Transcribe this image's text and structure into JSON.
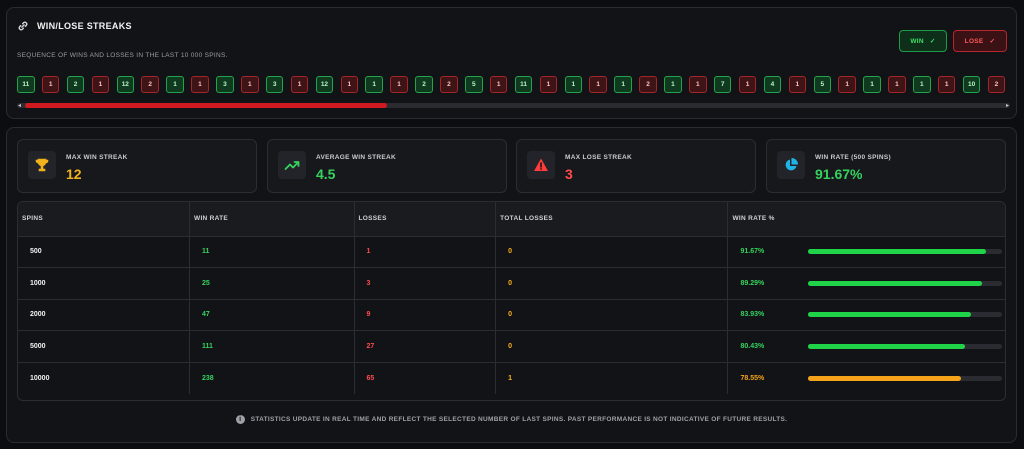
{
  "streaks": {
    "title": "WIN/LOSE STREAKS",
    "subtitle": "SEQUENCE OF WINS AND LOSSES IN THE LAST 10 000 SPINS.",
    "win_label": "WIN",
    "lose_label": "LOSE",
    "sequence": [
      {
        "t": "w",
        "v": "11"
      },
      {
        "t": "l",
        "v": "1"
      },
      {
        "t": "w",
        "v": "2"
      },
      {
        "t": "l",
        "v": "1"
      },
      {
        "t": "w",
        "v": "12"
      },
      {
        "t": "l",
        "v": "2"
      },
      {
        "t": "w",
        "v": "1"
      },
      {
        "t": "l",
        "v": "1"
      },
      {
        "t": "w",
        "v": "3"
      },
      {
        "t": "l",
        "v": "1"
      },
      {
        "t": "w",
        "v": "3"
      },
      {
        "t": "l",
        "v": "1"
      },
      {
        "t": "w",
        "v": "12"
      },
      {
        "t": "l",
        "v": "1"
      },
      {
        "t": "w",
        "v": "1"
      },
      {
        "t": "l",
        "v": "1"
      },
      {
        "t": "w",
        "v": "2"
      },
      {
        "t": "l",
        "v": "2"
      },
      {
        "t": "w",
        "v": "5"
      },
      {
        "t": "l",
        "v": "1"
      },
      {
        "t": "w",
        "v": "11"
      },
      {
        "t": "l",
        "v": "1"
      },
      {
        "t": "w",
        "v": "1"
      },
      {
        "t": "l",
        "v": "1"
      },
      {
        "t": "w",
        "v": "1"
      },
      {
        "t": "l",
        "v": "2"
      },
      {
        "t": "w",
        "v": "1"
      },
      {
        "t": "l",
        "v": "1"
      },
      {
        "t": "w",
        "v": "7"
      },
      {
        "t": "l",
        "v": "1"
      },
      {
        "t": "w",
        "v": "4"
      },
      {
        "t": "l",
        "v": "1"
      },
      {
        "t": "w",
        "v": "5"
      },
      {
        "t": "l",
        "v": "1"
      },
      {
        "t": "w",
        "v": "1"
      },
      {
        "t": "l",
        "v": "1"
      },
      {
        "t": "w",
        "v": "1"
      },
      {
        "t": "l",
        "v": "1"
      },
      {
        "t": "w",
        "v": "10"
      },
      {
        "t": "l",
        "v": "2"
      }
    ]
  },
  "cards": [
    {
      "label": "MAX WIN STREAK",
      "value": "12",
      "icon": "trophy-icon",
      "color": "#f2b21c"
    },
    {
      "label": "AVERAGE WIN STREAK",
      "value": "4.5",
      "icon": "trend-up-icon",
      "color": "#35d35e"
    },
    {
      "label": "MAX LOSE STREAK",
      "value": "3",
      "icon": "warning-icon",
      "color": "#ff4b4b"
    },
    {
      "label": "WIN RATE (500 SPINS)",
      "value": "91.67%",
      "icon": "pie-chart-icon",
      "color": "#35d35e"
    }
  ],
  "table": {
    "headers": [
      "SPINS",
      "WIN RATE",
      "LOSSES",
      "TOTAL LOSSES",
      "WIN RATE %"
    ],
    "rows": [
      {
        "spins": "500",
        "wins": "11",
        "losses": "1",
        "total": "0",
        "rate": "91.67%",
        "pct": 91.67,
        "color": "#20d44a"
      },
      {
        "spins": "1000",
        "wins": "25",
        "losses": "3",
        "total": "0",
        "rate": "89.29%",
        "pct": 89.29,
        "color": "#20d44a"
      },
      {
        "spins": "2000",
        "wins": "47",
        "losses": "9",
        "total": "0",
        "rate": "83.93%",
        "pct": 83.93,
        "color": "#20d44a"
      },
      {
        "spins": "5000",
        "wins": "111",
        "losses": "27",
        "total": "0",
        "rate": "80.43%",
        "pct": 80.43,
        "color": "#20d44a"
      },
      {
        "spins": "10000",
        "wins": "238",
        "losses": "65",
        "total": "1",
        "rate": "78.55%",
        "pct": 78.55,
        "color": "#f5a41a"
      }
    ]
  },
  "footer": {
    "text": "STATISTICS UPDATE IN REAL TIME AND REFLECT THE SELECTED NUMBER OF LAST SPINS. PAST PERFORMANCE IS NOT INDICATIVE OF FUTURE RESULTS."
  }
}
